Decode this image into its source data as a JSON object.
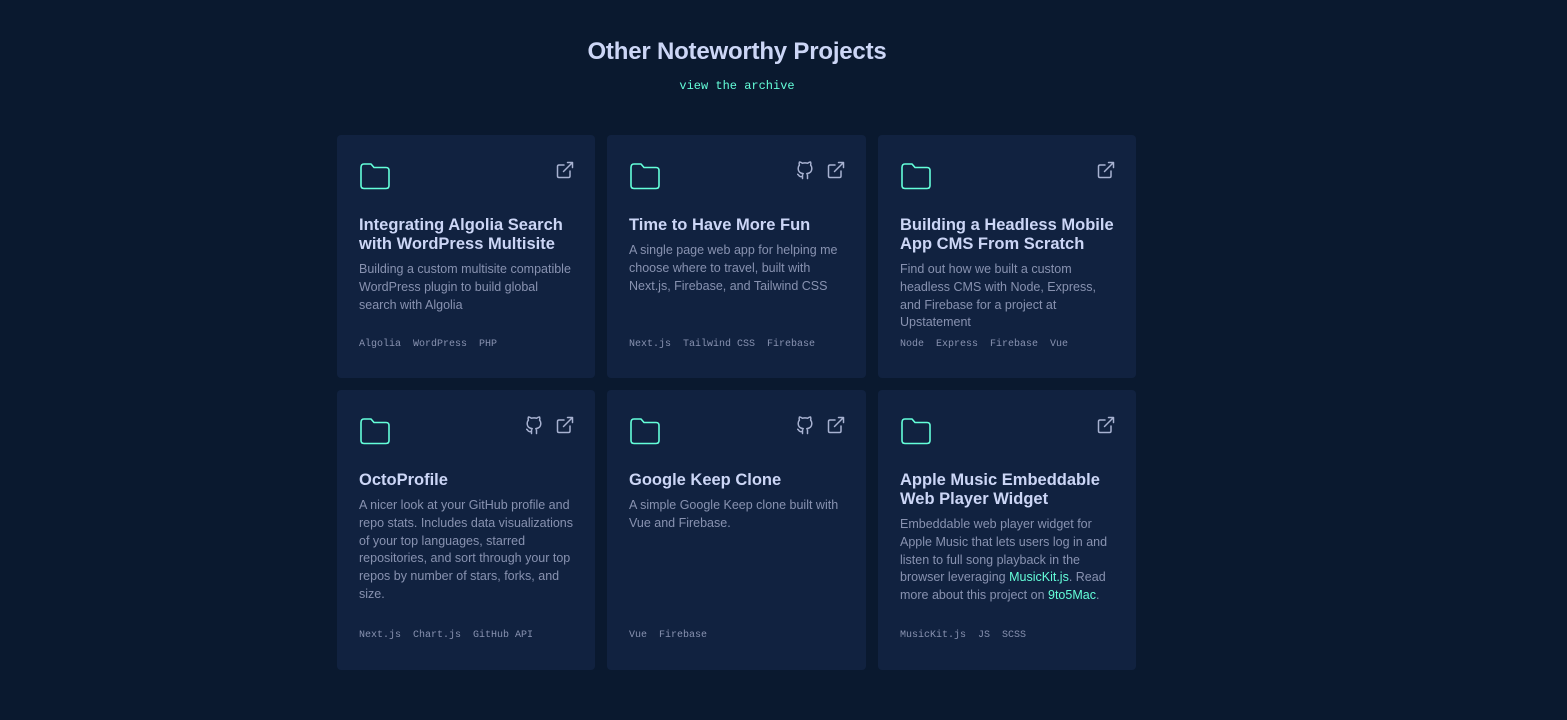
{
  "section": {
    "heading": "Other Noteworthy Projects",
    "archive_link": "view the archive"
  },
  "colors": {
    "background": "#0a192f",
    "card": "#112240",
    "accent": "#64ffda",
    "title": "#ccd6f6",
    "text": "#8892b0"
  },
  "projects": [
    {
      "title": "Integrating Algolia Search with WordPress Multisite",
      "description": "Building a custom multisite compatible WordPress plugin to build global search with Algolia",
      "tags": [
        "Algolia",
        "WordPress",
        "PHP"
      ],
      "icons": [
        "folder-icon",
        "external-link-icon"
      ]
    },
    {
      "title": "Time to Have More Fun",
      "description": "A single page web app for helping me choose where to travel, built with Next.js, Firebase, and Tailwind CSS",
      "tags": [
        "Next.js",
        "Tailwind CSS",
        "Firebase"
      ],
      "icons": [
        "folder-icon",
        "github-icon",
        "external-link-icon"
      ]
    },
    {
      "title": "Building a Headless Mobile App CMS From Scratch",
      "description": "Find out how we built a custom headless CMS with Node, Express, and Firebase for a project at Upstatement",
      "tags": [
        "Node",
        "Express",
        "Firebase",
        "Vue"
      ],
      "icons": [
        "folder-icon",
        "external-link-icon"
      ]
    },
    {
      "title": "OctoProfile",
      "description": "A nicer look at your GitHub profile and repo stats. Includes data visualizations of your top languages, starred repositories, and sort through your top repos by number of stars, forks, and size.",
      "tags": [
        "Next.js",
        "Chart.js",
        "GitHub API"
      ],
      "icons": [
        "folder-icon",
        "github-icon",
        "external-link-icon"
      ]
    },
    {
      "title": "Google Keep Clone",
      "description": "A simple Google Keep clone built with Vue and Firebase.",
      "tags": [
        "Vue",
        "Firebase"
      ],
      "icons": [
        "folder-icon",
        "github-icon",
        "external-link-icon"
      ]
    },
    {
      "title": "Apple Music Embeddable Web Player Widget",
      "description_parts": {
        "pre": "Embeddable web player widget for Apple Music that lets users log in and listen to full song playback in the browser leveraging ",
        "link1": "MusicKit.js",
        "mid": ". Read more about this project on ",
        "link2": "9to5Mac",
        "post": "."
      },
      "tags": [
        "MusicKit.js",
        "JS",
        "SCSS"
      ],
      "icons": [
        "folder-icon",
        "external-link-icon"
      ]
    }
  ]
}
